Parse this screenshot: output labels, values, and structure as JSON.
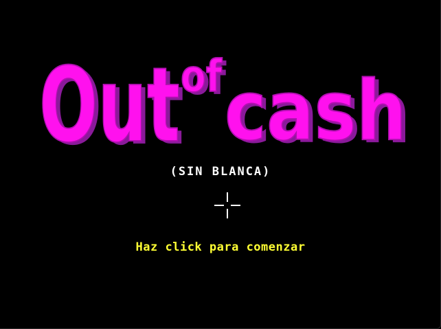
{
  "game": {
    "title_logo": "Outofcash",
    "title_parts": {
      "out": "Out",
      "of": "of",
      "cash": "cash"
    },
    "subtitle": "(SIN BLANCA)",
    "start_prompt": "Haz click para comenzar",
    "cursor_icon": "crosshair-icon"
  },
  "colors": {
    "background": "#000000",
    "logo_fill": "#ff11ee",
    "logo_shadow": "#8a1a9a",
    "subtitle": "#ffffff",
    "prompt": "#ffff33"
  }
}
